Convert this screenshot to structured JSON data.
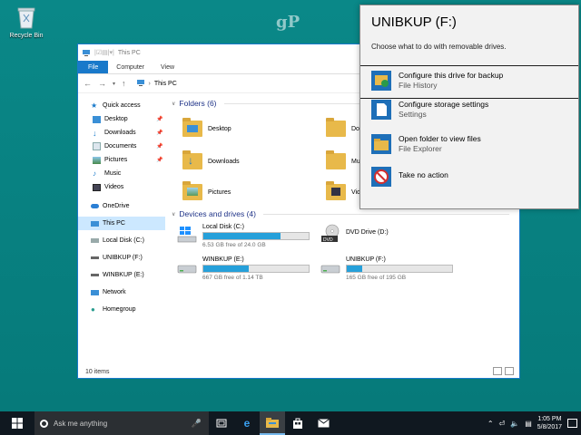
{
  "desktop": {
    "recycle_bin_label": "Recycle Bin",
    "watermark": "gP"
  },
  "explorer": {
    "title": "This PC",
    "tabs": [
      "File",
      "Computer",
      "View"
    ],
    "breadcrumb": "This PC",
    "nav": [
      {
        "label": "Quick access",
        "icon": "star-icon"
      },
      {
        "label": "Desktop",
        "icon": "desktop-icon"
      },
      {
        "label": "Downloads",
        "icon": "download-icon"
      },
      {
        "label": "Documents",
        "icon": "documents-icon"
      },
      {
        "label": "Pictures",
        "icon": "pictures-icon"
      },
      {
        "label": "Music",
        "icon": "music-icon"
      },
      {
        "label": "Videos",
        "icon": "videos-icon"
      },
      {
        "label": "OneDrive",
        "icon": "cloud-icon"
      },
      {
        "label": "This PC",
        "icon": "computer-icon"
      },
      {
        "label": "Local Disk (C:)",
        "icon": "drive-icon"
      },
      {
        "label": "UNIBKUP (F:)",
        "icon": "drive-icon"
      },
      {
        "label": "WINBKUP (E:)",
        "icon": "drive-icon"
      },
      {
        "label": "Network",
        "icon": "network-icon"
      },
      {
        "label": "Homegroup",
        "icon": "homegroup-icon"
      }
    ],
    "folders_header": "Folders (6)",
    "folders": [
      "Desktop",
      "Do",
      "Downloads",
      "Mu",
      "Pictures",
      "Vid"
    ],
    "drives_header": "Devices and drives (4)",
    "drives": [
      {
        "name": "Local Disk (C:)",
        "free": "6.53 GB free of 24.0 GB",
        "used_fraction": 0.73
      },
      {
        "name": "DVD Drive (D:)",
        "free": "",
        "used_fraction": null
      },
      {
        "name": "WINBKUP (E:)",
        "free": "667 GB free of 1.14 TB",
        "used_fraction": 0.43
      },
      {
        "name": "UNIBKUP (F:)",
        "free": "165 GB free of 195 GB",
        "used_fraction": 0.15
      }
    ],
    "status": "10 items"
  },
  "popup": {
    "title": "UNIBKUP (F:)",
    "subtitle": "Choose what to do with removable drives.",
    "options": [
      {
        "title": "Configure this drive for backup",
        "subtitle": "File History"
      },
      {
        "title": "Configure storage settings",
        "subtitle": "Settings"
      },
      {
        "title": "Open folder to view files",
        "subtitle": "File Explorer"
      },
      {
        "title": "Take no action",
        "subtitle": ""
      }
    ]
  },
  "taskbar": {
    "search_placeholder": "Ask me anything",
    "time": "1:05 PM",
    "date": "5/8/2017"
  },
  "colors": {
    "accent": "#1979ca",
    "desktop": "#008080",
    "bar_fill": "#26a0da"
  }
}
